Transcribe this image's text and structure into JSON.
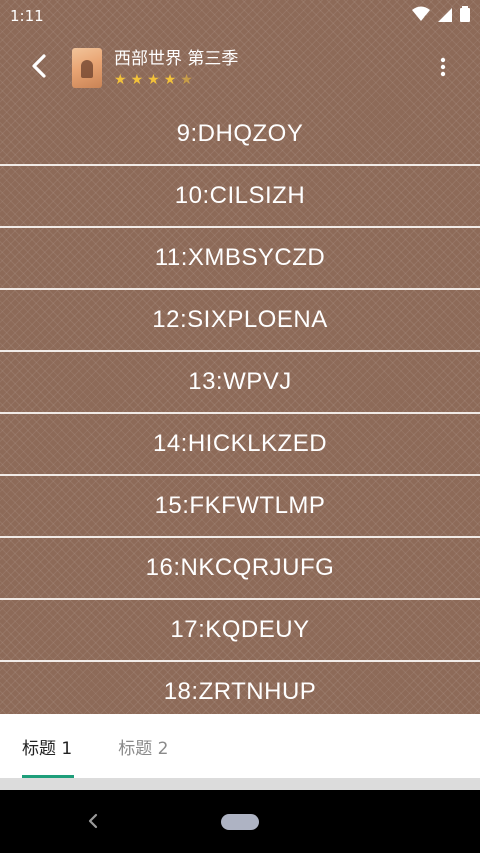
{
  "status_bar": {
    "time": "1:11"
  },
  "toolbar": {
    "title": "西部世界 第三季",
    "stars": [
      "★",
      "★",
      "★",
      "★",
      "★"
    ]
  },
  "episodes": [
    "9:DHQZOY",
    "10:CILSIZH",
    "11:XMBSYCZD",
    "12:SIXPLOENA",
    "13:WPVJ",
    "14:HICKLKZED",
    "15:FKFWTLMP",
    "16:NKCQRJUFG",
    "17:KQDEUY",
    "18:ZRTNHUP"
  ],
  "tabs": [
    {
      "label": "标题 1",
      "active": true
    },
    {
      "label": "标题 2",
      "active": false
    }
  ],
  "colors": {
    "background": "#8d6a58",
    "accent": "#1e9e7a",
    "star": "#f3c23a"
  }
}
